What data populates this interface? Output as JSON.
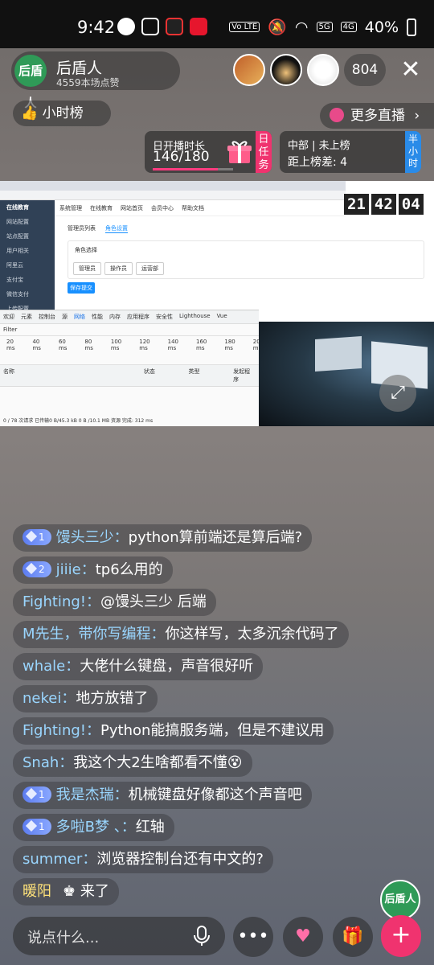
{
  "statusbar": {
    "time": "9:42",
    "network": "5G",
    "network2": "4G",
    "volte": "Vo LTE",
    "battery": "40%"
  },
  "host": {
    "avatar_text": "后盾人",
    "name": "后盾人",
    "likes": "4559本场点赞"
  },
  "viewers": {
    "count": "804",
    "badge_level": "1"
  },
  "hour_rank": {
    "label": "小时榜"
  },
  "more_live": {
    "label": "更多直播"
  },
  "task": {
    "title": "日开播时长",
    "progress_text": "146/180",
    "progress_fraction": 0.81,
    "tag": "日任务"
  },
  "rank": {
    "region": "中部",
    "status": "未上榜",
    "gap_label": "距上榜差: 4",
    "tag": "半小时"
  },
  "stream": {
    "clock": [
      "21",
      "42",
      "04"
    ],
    "sidebar_title": "在线教育",
    "sidebar_items": [
      "网站配置",
      "站点配置",
      "用户相关",
      "阿里云",
      "支付宝",
      "微信支付",
      "上传配置",
      "邮箱配置"
    ],
    "topnav": [
      "系统管理",
      "在线教育",
      "网站首页",
      "会员中心",
      "帮助文档"
    ],
    "subtabs": [
      "管理员列表",
      "角色设置"
    ],
    "panel_title": "角色选择",
    "panel_buttons": [
      "管理员",
      "操作员",
      "运营部"
    ],
    "save_button": "保存提交",
    "devtools_tabs": [
      "欢迎",
      "元素",
      "控制台",
      "源",
      "网络",
      "性能",
      "内存",
      "应用程序",
      "安全性",
      "Lighthouse",
      "Vue"
    ],
    "devtools_filter": "Filter",
    "timeline": [
      "20 ms",
      "40 ms",
      "60 ms",
      "80 ms",
      "100 ms",
      "120 ms",
      "140 ms",
      "160 ms",
      "180 ms",
      "200 ms"
    ],
    "columns": [
      "名称",
      "状态",
      "类型",
      "发起程序"
    ],
    "footer": "0 / 78 次请求  已传输0 B/45.3 kB  0 B /10.1 MB 资源  完成: 312 ms"
  },
  "chat": [
    {
      "badge": "1",
      "user": "馒头三少",
      "text": "python算前端还是算后端?"
    },
    {
      "badge": "2",
      "user": "jiiie",
      "text": "tp6么用的"
    },
    {
      "badge": "",
      "user": "Fighting!",
      "text": "@馒头三少 后端"
    },
    {
      "badge": "",
      "user": "M先生，带你写编程",
      "text": "你这样写，太多沉余代码了"
    },
    {
      "badge": "",
      "user": "whale",
      "text": "大佬什么键盘，声音很好听"
    },
    {
      "badge": "",
      "user": "nekei",
      "text": "地方放错了"
    },
    {
      "badge": "",
      "user": "Fighting!",
      "text": "Python能搞服务端，但是不建议用"
    },
    {
      "badge": "",
      "user": "Snah",
      "text": "我这个大2生啥都看不懂😵"
    },
    {
      "badge": "1",
      "user": "我是杰瑞",
      "text": "机械键盘好像都这个声音吧"
    },
    {
      "badge": "1",
      "user": "多啦B梦 、",
      "text": "红轴"
    },
    {
      "badge": "",
      "user": "summer",
      "text": "浏览器控制台还有中文的?"
    }
  ],
  "welcome": {
    "name": "暖阳",
    "text": "来了"
  },
  "input": {
    "placeholder": "说点什么..."
  },
  "colors": {
    "accent": "#f0336f",
    "username": "#9ad6ff",
    "host_green": "#2f9a57",
    "badge_blue": "#5c7cf0"
  }
}
